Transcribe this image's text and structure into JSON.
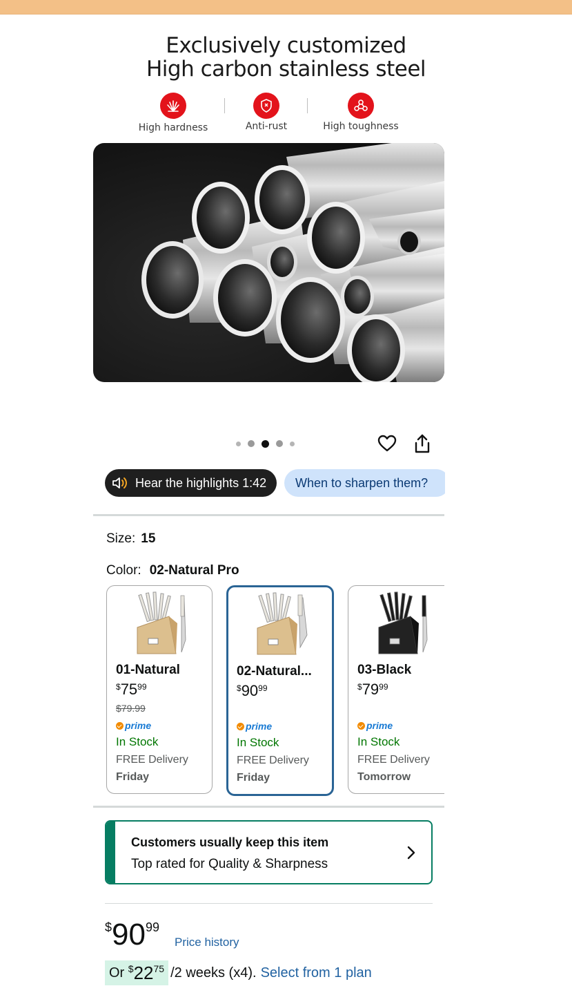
{
  "hero": {
    "title_line1": "Exclusively customized",
    "title_line2": "High carbon stainless steel",
    "features": [
      {
        "label": "High hardness",
        "icon": "hardness-icon"
      },
      {
        "label": "Anti-rust",
        "icon": "shield-icon"
      },
      {
        "label": "High toughness",
        "icon": "toughness-icon"
      }
    ],
    "accent_color": "#e3131b"
  },
  "carousel": {
    "dot_count": 5,
    "active_dot": 3
  },
  "chips": {
    "audio_label": "Hear the highlights 1:42",
    "question_label": "When to sharpen them?"
  },
  "size": {
    "label": "Size:",
    "value": "15"
  },
  "color": {
    "label": "Color:",
    "value": "02-Natural Pro"
  },
  "variants": [
    {
      "name": "01-Natural",
      "price_whole": "75",
      "price_cents": "99",
      "list_price": "$79.99",
      "prime": "prime",
      "stock": "In Stock",
      "delivery": "FREE Delivery",
      "day": "Friday",
      "style": "natural"
    },
    {
      "name": "02-Natural...",
      "price_whole": "90",
      "price_cents": "99",
      "list_price": "",
      "prime": "prime",
      "stock": "In Stock",
      "delivery": "FREE Delivery",
      "day": "Friday",
      "style": "natural",
      "selected": true
    },
    {
      "name": "03-Black",
      "price_whole": "79",
      "price_cents": "99",
      "list_price": "",
      "prime": "prime",
      "stock": "In Stock",
      "delivery": "FREE Delivery",
      "day": "Tomorrow",
      "style": "black"
    }
  ],
  "keep_badge": {
    "title": "Customers usually keep this item",
    "subtitle": "Top rated for Quality & Sharpness",
    "accent_color": "#067d62"
  },
  "price": {
    "currency": "$",
    "whole": "90",
    "cents": "99",
    "history_link": "Price history"
  },
  "installment": {
    "prefix": "Or",
    "currency": "$",
    "whole": "22",
    "cents": "75",
    "period": "/2 weeks (x4).",
    "link": "Select from 1 plan"
  }
}
